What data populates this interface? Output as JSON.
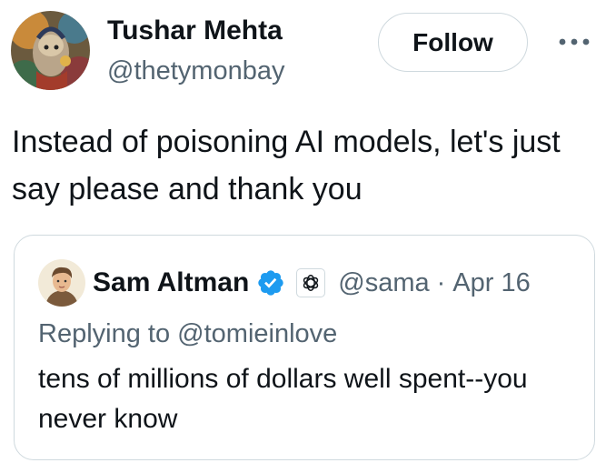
{
  "author": {
    "name": "Tushar Mehta",
    "handle": "@thetymonbay",
    "avatar_icon": "illustrated-avatar"
  },
  "actions": {
    "follow_label": "Follow",
    "more_icon": "more-horizontal-icon"
  },
  "tweet": {
    "text": "Instead of poisoning AI models, let's just say please and thank you"
  },
  "quote": {
    "name": "Sam Altman",
    "verified_icon": "verified-badge-icon",
    "affiliate_icon": "openai-logo-icon",
    "handle": "@sama",
    "separator": "·",
    "date": "Apr 16",
    "replying_prefix": "Replying to",
    "replying_to": "@tomieinlove",
    "text": "tens of millions of dollars well spent--you never know"
  },
  "colors": {
    "text_primary": "#0f1419",
    "text_secondary": "#536471",
    "border": "#cfd9de",
    "verified_blue": "#1d9bf0"
  }
}
